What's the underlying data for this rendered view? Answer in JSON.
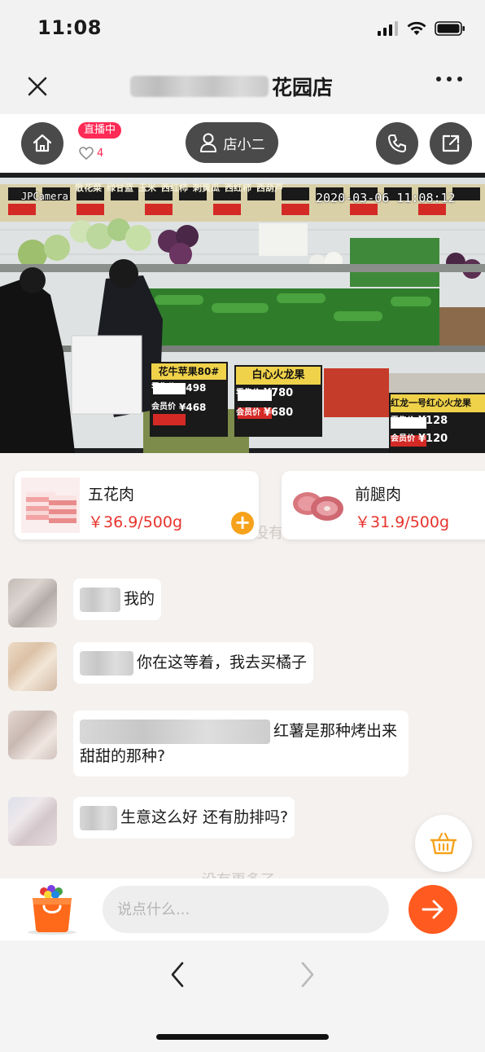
{
  "status_bar": {
    "time": "11:08"
  },
  "nav": {
    "title_suffix": "花园店"
  },
  "live": {
    "badge": "直播中",
    "likes": "4",
    "host_label": "店小二"
  },
  "video": {
    "watermark": "JPCamera",
    "timestamp": "2020-03-06 11:08:12",
    "price_tags": [
      {
        "name": "花牛苹果80#",
        "sale_label": "零售价",
        "sale_price": "¥498",
        "member_label": "会员价",
        "member_price": "¥468"
      },
      {
        "name": "白心火龙果",
        "sale_label": "零售价",
        "sale_price": "¥780",
        "member_label": "会员价",
        "member_price": "¥680"
      },
      {
        "name": "红龙一号红心火龙果",
        "sale_label": "零售价",
        "sale_price": "¥128",
        "member_label": "会员价",
        "member_price": "¥120"
      }
    ],
    "shelf_labels": [
      "散花菜",
      "绿甘蓝",
      "玉米",
      "西红柿",
      "刺黄瓜",
      "西红柿",
      "西葫芦"
    ]
  },
  "products": [
    {
      "name": "五花肉",
      "price": "￥36.9/500g"
    },
    {
      "name": "前腿肉",
      "price": "￥31.9/500g"
    }
  ],
  "faded_top": "没有",
  "messages": [
    {
      "text": "我的"
    },
    {
      "text": "你在这等着，我去买橘子"
    },
    {
      "text_line1": "红薯是那种烤出来",
      "text_line2": "甜甜的那种?"
    },
    {
      "text": "生意这么好 还有肋排吗?"
    }
  ],
  "faded_bottom": "没有更多了",
  "input": {
    "placeholder": "说点什么..."
  },
  "colors": {
    "accent": "#ff5a1f",
    "price": "#e8332c",
    "live_badge": "#ff2a55",
    "add_button": "#f7a21b"
  },
  "icons": [
    "close-icon",
    "more-icon",
    "home-icon",
    "heart-icon",
    "user-icon",
    "phone-icon",
    "share-icon",
    "add-icon",
    "basket-icon",
    "shopping-bag-icon",
    "arrow-right-icon",
    "chevron-left-icon",
    "chevron-right-icon"
  ]
}
